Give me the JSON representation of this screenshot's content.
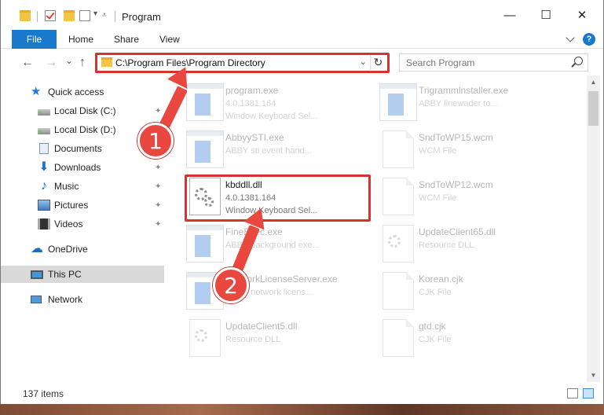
{
  "window": {
    "title": "Program",
    "controls": {
      "minimize": "—",
      "maximize": "☐",
      "close": "✕"
    }
  },
  "ribbon": {
    "tabs": [
      "File",
      "Home",
      "Share",
      "View"
    ],
    "help": "?"
  },
  "navigation": {
    "back": "←",
    "forward": "→",
    "recent": "⌄",
    "up": "↑"
  },
  "address": {
    "path": "C:\\Program Files\\Program Directory",
    "refresh": "↻",
    "dropdown": "⌄"
  },
  "search": {
    "placeholder": "Search Program"
  },
  "sidebar": {
    "items": [
      {
        "label": "Quick access",
        "icon": "star-icon",
        "pinned": false
      },
      {
        "label": "Local Disk (C:)",
        "icon": "disk-icon",
        "pinned": true
      },
      {
        "label": "Local Disk (D:)",
        "icon": "disk-icon",
        "pinned": false
      },
      {
        "label": "Documents",
        "icon": "documents-icon",
        "pinned": true
      },
      {
        "label": "Downloads",
        "icon": "downloads-icon",
        "pinned": true
      },
      {
        "label": "Music",
        "icon": "music-icon",
        "pinned": true
      },
      {
        "label": "Pictures",
        "icon": "pictures-icon",
        "pinned": true
      },
      {
        "label": "Videos",
        "icon": "videos-icon",
        "pinned": true
      },
      {
        "label": "OneDrive",
        "icon": "onedrive-icon",
        "pinned": false
      },
      {
        "label": "This PC",
        "icon": "pc-icon",
        "pinned": false,
        "selected": true
      },
      {
        "label": "Network",
        "icon": "network-icon",
        "pinned": false
      }
    ],
    "pin_glyph": "📌"
  },
  "files": [
    {
      "name": "program.exe",
      "line2": "4.0.1381.164",
      "line3": "Window Keyboard Sel...",
      "kind": "exe"
    },
    {
      "name": "Trigrammlnstaller.exe",
      "line2": "ABBY linewader to...",
      "line3": "",
      "kind": "exe"
    },
    {
      "name": "AbbyySTI.exe",
      "line2": "ABBY sti event hand...",
      "line3": "",
      "kind": "exe"
    },
    {
      "name": "SndToWP15.wcm",
      "line2": "WCM File",
      "line3": "",
      "kind": "doc"
    },
    {
      "name": "kbddll.dll",
      "line2": "4.0.1381.164",
      "line3": "Window Keyboard Sel...",
      "kind": "dll",
      "highlighted": true
    },
    {
      "name": "SndToWP12.wcm",
      "line2": "WCM File",
      "line3": "",
      "kind": "doc"
    },
    {
      "name": "FineExec.exe",
      "line2": "ABBY background exe...",
      "line3": "",
      "kind": "exe"
    },
    {
      "name": "UpdateClient65.dll",
      "line2": "Resource DLL",
      "line3": "",
      "kind": "dll"
    },
    {
      "name": "NetworkLicenseServer.exe",
      "line2": "ABBY network licens...",
      "line3": "",
      "kind": "exe"
    },
    {
      "name": "Korean.cjk",
      "line2": "CJK File",
      "line3": "",
      "kind": "doc"
    },
    {
      "name": "UpdateClient5.dll",
      "line2": "Resource DLL",
      "line3": "",
      "kind": "dll"
    },
    {
      "name": "gtd.cjk",
      "line2": "CJK File",
      "line3": "",
      "kind": "doc"
    }
  ],
  "status": {
    "item_count": "137 items"
  },
  "annotations": {
    "step1": "1",
    "step2": "2"
  },
  "colors": {
    "accent": "#1979ca",
    "highlight": "#d8322e",
    "annotation": "#e8483f"
  }
}
